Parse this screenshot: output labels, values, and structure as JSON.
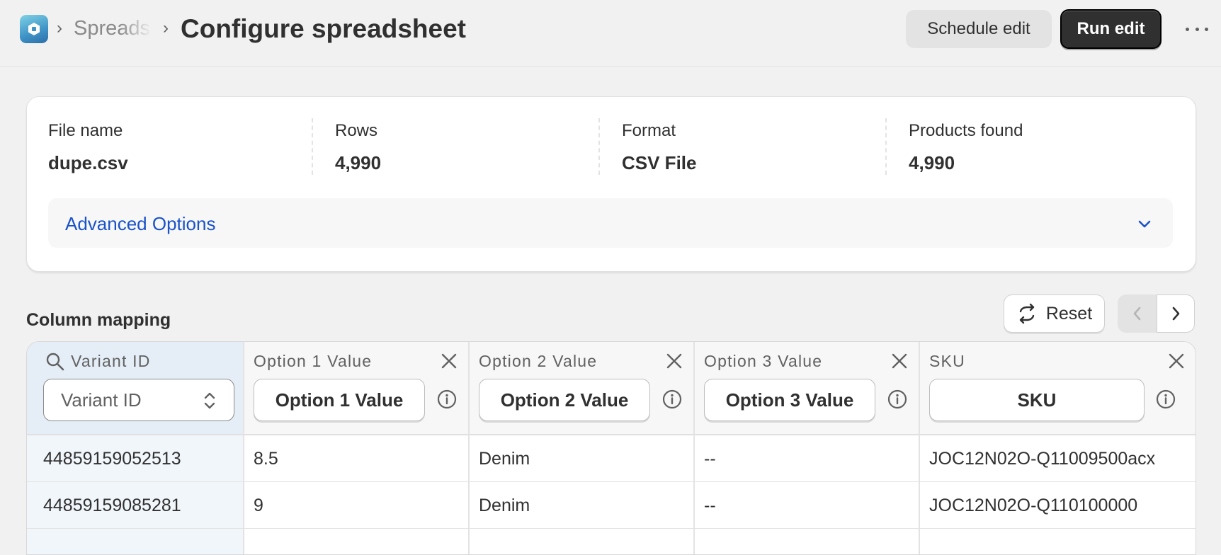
{
  "header": {
    "breadcrumb_parent": "Spreadsheets",
    "breadcrumb_separator": "›",
    "title": "Configure spreadsheet",
    "schedule_label": "Schedule edit",
    "run_label": "Run edit"
  },
  "summary": {
    "stats": [
      {
        "label": "File name",
        "value": "dupe.csv"
      },
      {
        "label": "Rows",
        "value": "4,990"
      },
      {
        "label": "Format",
        "value": "CSV File"
      },
      {
        "label": "Products found",
        "value": "4,990"
      }
    ],
    "advanced_label": "Advanced Options"
  },
  "mapping": {
    "title": "Column mapping",
    "reset_label": "Reset",
    "columns": [
      {
        "title": "Variant ID",
        "select_value": "Variant ID"
      },
      {
        "title": "Option 1 Value",
        "select_value": "Option 1 Value"
      },
      {
        "title": "Option 2 Value",
        "select_value": "Option 2 Value"
      },
      {
        "title": "Option 3 Value",
        "select_value": "Option 3 Value"
      },
      {
        "title": "SKU",
        "select_value": "SKU"
      }
    ],
    "rows": [
      [
        "44859159052513",
        "8.5",
        "Denim",
        "--",
        "JOC12N02O-Q11009500acx"
      ],
      [
        "44859159085281",
        "9",
        "Denim",
        "--",
        "JOC12N02O-Q110100000"
      ],
      [
        "",
        "",
        "",
        "",
        ""
      ]
    ]
  },
  "colors": {
    "accent_link": "#1a52c8",
    "primary_button": "#303030",
    "background": "#f1f1f1"
  }
}
